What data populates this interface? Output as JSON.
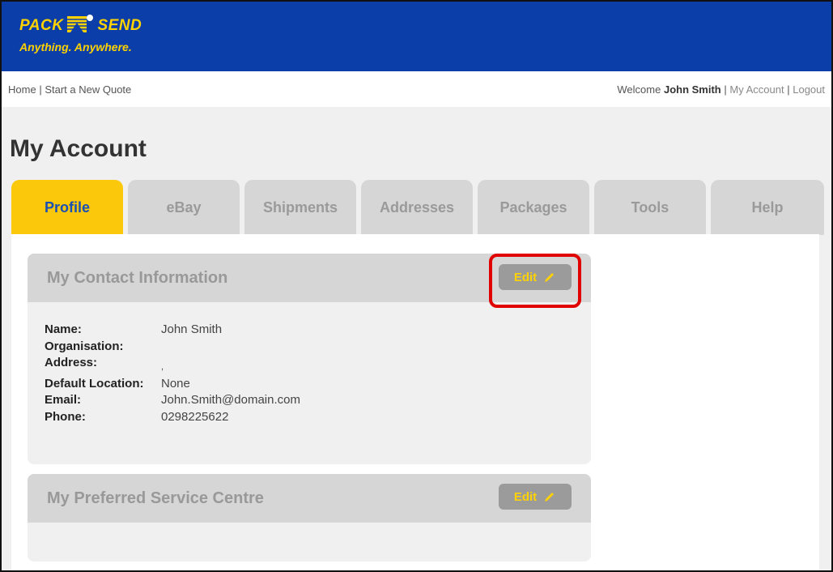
{
  "brand": {
    "word_left": "PACK",
    "word_right": "SEND",
    "tagline": "Anything. Anywhere.",
    "colors": {
      "header": "#0b3ea8",
      "accent": "#ffd200",
      "tab_active": "#fcc80b",
      "highlight": "#e00000"
    }
  },
  "nav": {
    "home": "Home",
    "sep": "|",
    "new_quote": "Start a New Quote",
    "welcome": "Welcome",
    "user_name": "John Smith",
    "my_account": "My Account",
    "logout": "Logout"
  },
  "page": {
    "title": "My Account"
  },
  "tabs": [
    {
      "label": "Profile",
      "active": true
    },
    {
      "label": "eBay",
      "active": false
    },
    {
      "label": "Shipments",
      "active": false
    },
    {
      "label": "Addresses",
      "active": false
    },
    {
      "label": "Packages",
      "active": false
    },
    {
      "label": "Tools",
      "active": false
    },
    {
      "label": "Help",
      "active": false
    }
  ],
  "contact": {
    "title": "My Contact Information",
    "edit_label": "Edit",
    "edit_icon": "pencil-icon",
    "fields": [
      {
        "label": "Name:",
        "value": "John Smith"
      },
      {
        "label": "Organisation:",
        "value": ""
      },
      {
        "label": "Address:",
        "value": ","
      },
      {
        "label": "Default Location:",
        "value": "None"
      },
      {
        "label": "Email:",
        "value": "John.Smith@domain.com"
      },
      {
        "label": "Phone:",
        "value": "0298225622"
      }
    ]
  },
  "service_centre": {
    "title": "My Preferred Service Centre",
    "edit_label": "Edit",
    "edit_icon": "pencil-icon"
  }
}
